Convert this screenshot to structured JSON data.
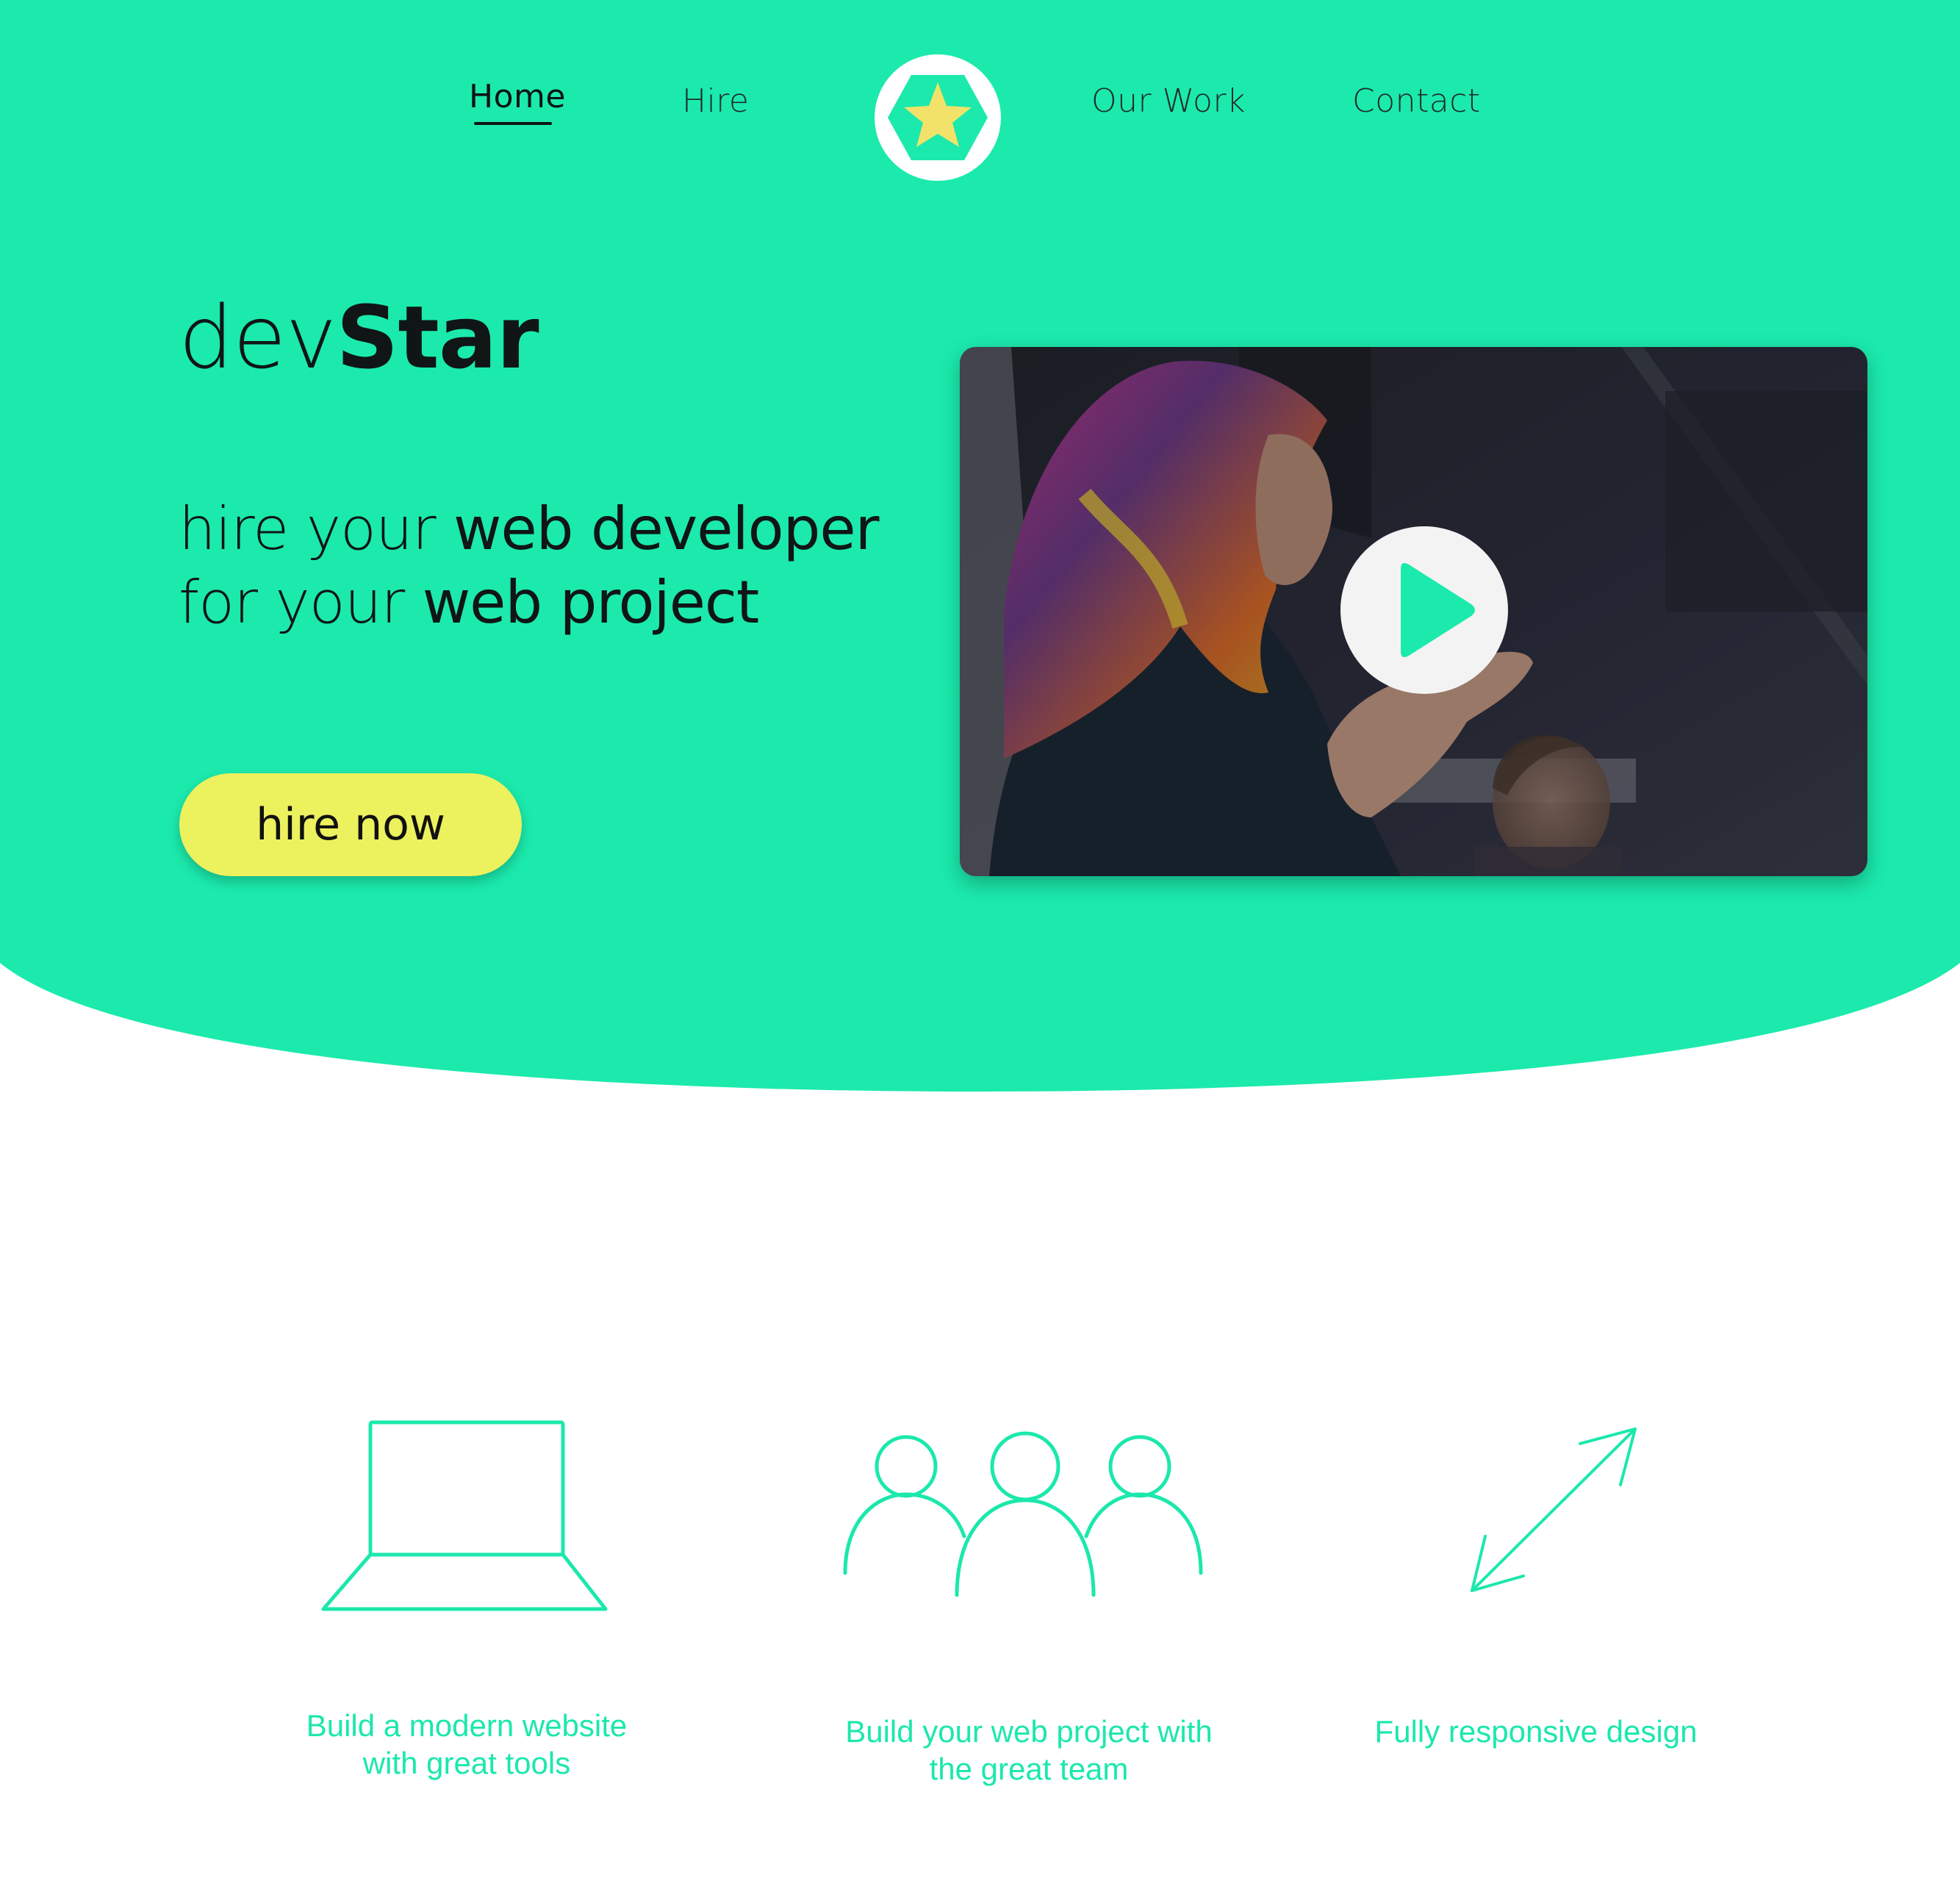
{
  "colors": {
    "brand_green": "#1beaac",
    "accent_yellow": "#ecf15e",
    "star_yellow": "#f2e26a",
    "text_dark": "#101515",
    "background": "#ffffff"
  },
  "nav": {
    "items": [
      {
        "label": "Home",
        "active": true
      },
      {
        "label": "Hire",
        "active": false
      },
      {
        "label": "Our Work",
        "active": false
      },
      {
        "label": "Contact",
        "active": false
      }
    ],
    "logo_icon": "hexagon-star-icon"
  },
  "hero": {
    "brand_light": "dev",
    "brand_bold": "Star",
    "tagline_line1_light": "hire your ",
    "tagline_line1_bold": "web developer",
    "tagline_line2_light": "for your ",
    "tagline_line2_bold": "web project",
    "cta_label": "hire now",
    "video_icon": "play-icon"
  },
  "features": [
    {
      "icon": "laptop-icon",
      "text": "Build a modern website\nwith great tools"
    },
    {
      "icon": "team-icon",
      "text": "Build your web project with\nthe great team"
    },
    {
      "icon": "resize-arrows-icon",
      "text": "Fully responsive design"
    }
  ]
}
